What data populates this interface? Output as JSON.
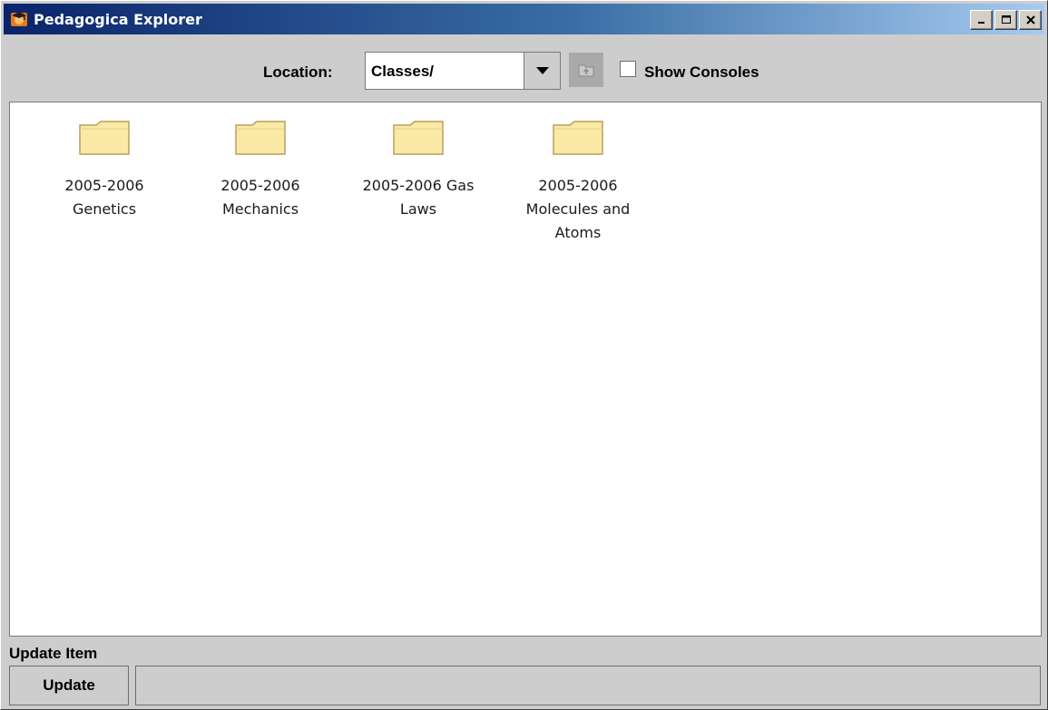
{
  "window": {
    "title": "Pedagogica Explorer",
    "accent_color": "#0a246a",
    "app_icon": "pedagogica-app-icon",
    "controls": [
      "minimize-icon",
      "maximize-icon",
      "close-icon"
    ]
  },
  "toolbar": {
    "location_label": "Location:",
    "location_value": "Classes/",
    "dropdown_icon": "chevron-down-icon",
    "up_icon": "up-folder-icon",
    "up_enabled": false,
    "show_consoles_label": "Show Consoles",
    "show_consoles_checked": false
  },
  "folders": [
    {
      "label": "2005-2006 Genetics",
      "icon": "folder-icon"
    },
    {
      "label": "2005-2006 Mechanics",
      "icon": "folder-icon"
    },
    {
      "label": "2005-2006 Gas Laws",
      "icon": "folder-icon"
    },
    {
      "label": "2005-2006 Molecules and Atoms",
      "icon": "folder-icon"
    }
  ],
  "footer": {
    "status_label": "Update Item",
    "update_button": "Update",
    "status_text": ""
  }
}
